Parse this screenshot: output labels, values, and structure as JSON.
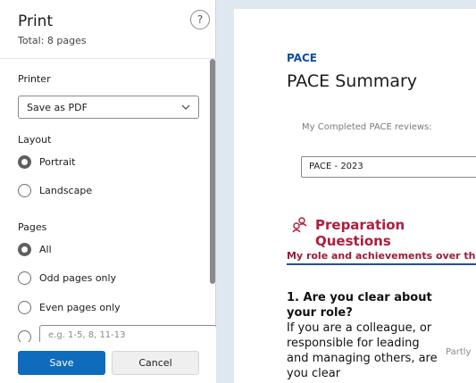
{
  "panel": {
    "title": "Print",
    "subtitle": "Total: 8 pages",
    "help_label": "?",
    "printer": {
      "label": "Printer",
      "selected": "Save as PDF"
    },
    "layout": {
      "label": "Layout",
      "options": [
        "Portrait",
        "Landscape"
      ],
      "selected": "Portrait"
    },
    "pages": {
      "label": "Pages",
      "options": [
        "All",
        "Odd pages only",
        "Even pages only"
      ],
      "selected": "All",
      "custom_placeholder": "e.g. 1-5, 8, 11-13"
    },
    "save_label": "Save",
    "cancel_label": "Cancel"
  },
  "preview": {
    "brand": "PACE",
    "title": "PACE Summary",
    "reviews_label": "My Completed PACE reviews:",
    "reviews_value": "PACE - 2023",
    "section_heading": "Preparation Questions",
    "subheading": "My role and achievements over the",
    "question": "1. Are you clear about your role?",
    "question_desc": "If you are a colleague, or responsible for leading and managing others, are you clear",
    "rating_label": "Partly"
  },
  "colors": {
    "primary_button": "#0f6cbd",
    "brand_blue": "#0f4ea3",
    "heading_red": "#b01c3e",
    "background": "#dfe7f0"
  }
}
